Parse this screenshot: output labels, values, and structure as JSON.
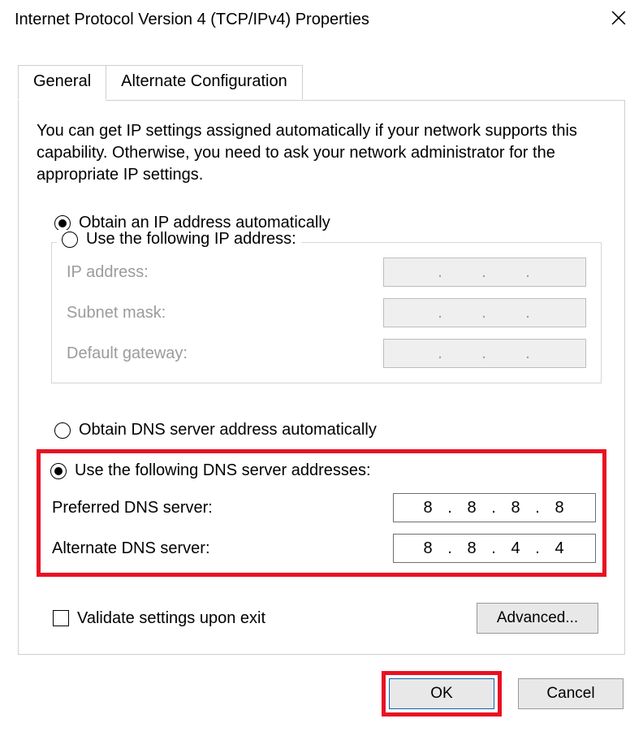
{
  "window": {
    "title": "Internet Protocol Version 4 (TCP/IPv4) Properties"
  },
  "tabs": {
    "general": "General",
    "alternate": "Alternate Configuration",
    "active": "general"
  },
  "description": "You can get IP settings assigned automatically if your network supports this capability. Otherwise, you need to ask your network administrator for the appropriate IP settings.",
  "ip": {
    "obtain_auto_label": "Obtain an IP address automatically",
    "use_following_label": "Use the following IP address:",
    "selected": "auto",
    "fields": {
      "ip_label": "IP address:",
      "subnet_label": "Subnet mask:",
      "gateway_label": "Default gateway:",
      "ip_value": [
        "",
        "",
        "",
        ""
      ],
      "subnet_value": [
        "",
        "",
        "",
        ""
      ],
      "gateway_value": [
        "",
        "",
        "",
        ""
      ]
    }
  },
  "dns": {
    "obtain_auto_label": "Obtain DNS server address automatically",
    "use_following_label": "Use the following DNS server addresses:",
    "selected": "manual",
    "fields": {
      "preferred_label": "Preferred DNS server:",
      "alternate_label": "Alternate DNS server:",
      "preferred_value": [
        "8",
        "8",
        "8",
        "8"
      ],
      "alternate_value": [
        "8",
        "8",
        "4",
        "4"
      ]
    }
  },
  "validate_label": "Validate settings upon exit",
  "validate_checked": false,
  "buttons": {
    "advanced": "Advanced...",
    "ok": "OK",
    "cancel": "Cancel"
  }
}
